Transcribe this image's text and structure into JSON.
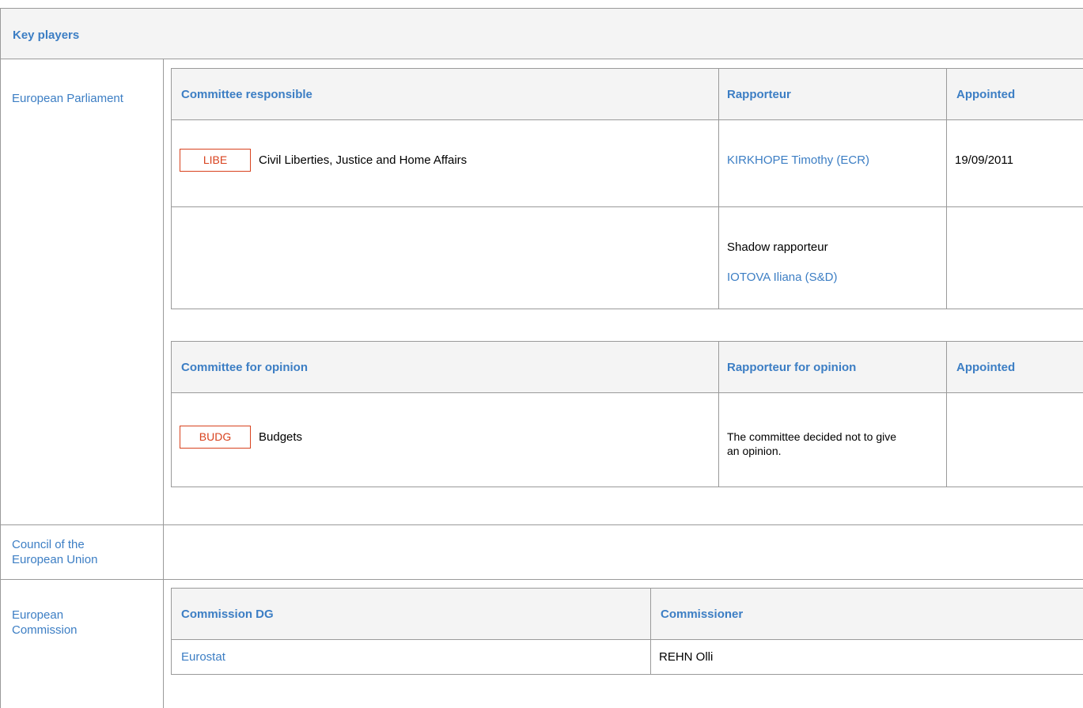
{
  "section_title": "Key players",
  "institutions": {
    "parliament": "European Parliament",
    "council": "Council of the European Union",
    "commission": "European Commission"
  },
  "responsible_table": {
    "headers": {
      "committee": "Committee responsible",
      "rapporteur": "Rapporteur",
      "appointed": "Appointed"
    },
    "row": {
      "badge": "LIBE",
      "committee_name": "Civil Liberties, Justice and Home Affairs",
      "rapporteur": "KIRKHOPE Timothy (ECR)",
      "appointed": "19/09/2011"
    },
    "shadow": {
      "label": "Shadow rapporteur",
      "name": "IOTOVA Iliana (S&D)"
    }
  },
  "opinion_table": {
    "headers": {
      "committee": "Committee for opinion",
      "rapporteur": "Rapporteur for opinion",
      "appointed": "Appointed"
    },
    "row": {
      "badge": "BUDG",
      "committee_name": "Budgets",
      "note": "The committee decided not to give an opinion."
    }
  },
  "commission_table": {
    "headers": {
      "dg": "Commission DG",
      "commissioner": "Commissioner"
    },
    "row": {
      "dg": "Eurostat",
      "commissioner": "REHN Olli"
    }
  },
  "colors": {
    "link": "#3c7ec4",
    "badge": "#d8421e",
    "header_bg": "#f4f4f4",
    "border": "#9a9a9a"
  }
}
